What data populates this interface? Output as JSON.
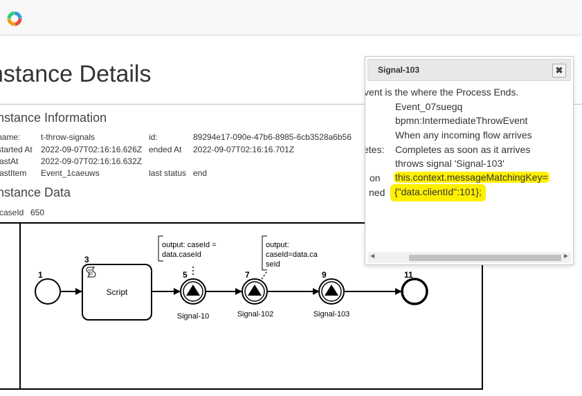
{
  "page": {
    "title": "nstance Details",
    "info_heading": "nstance Information",
    "data_heading": "nstance Data"
  },
  "info": {
    "name_label": "name:",
    "name_value": "t-throw-signals",
    "id_label": "id:",
    "id_value": "89294e17-090e-47b6-8985-6cb3528a6b56",
    "started_label": "started At",
    "started_value": "2022-09-07T02:16:16.626Z",
    "ended_label": "ended At",
    "ended_value": "2022-09-07T02:16:16.701Z",
    "lastat_label": "astAt",
    "lastat_value": "2022-09-07T02:16:16.632Z",
    "lastitem_label": "astItem",
    "lastitem_value": "Event_1caeuws",
    "laststatus_label": "last status",
    "laststatus_value": "end"
  },
  "instance_data": {
    "key": "caseId",
    "value": "650"
  },
  "diagram": {
    "start_num": "1",
    "task_num": "3",
    "task_label": "Script",
    "event5_num": "5",
    "event5_label": "Signal-10",
    "event7_num": "7",
    "event7_label": "Signal-102",
    "event9_num": "9",
    "event9_label": "Signal-103",
    "end_num": "11",
    "annotation1": [
      "output: caseId =",
      "data.caseId"
    ],
    "annotation2": [
      "output:",
      "caseId=data.ca",
      "seId"
    ]
  },
  "popup": {
    "title": "Signal-103",
    "close_label": "✖",
    "lines": [
      {
        "label": "",
        "value": "vent is the where the Process Ends."
      },
      {
        "label": "",
        "value": "Event_07suegq"
      },
      {
        "label": "",
        "value": "bpmn:IntermediateThrowEvent"
      },
      {
        "label": "",
        "value": "When any incoming flow arrives"
      },
      {
        "label": "etes:",
        "value": "Completes as soon as it arrives"
      },
      {
        "label": "",
        "value": "throws signal 'Signal-103'"
      },
      {
        "label": "on",
        "value": "this.context.messageMatchingKey="
      },
      {
        "label": "ned",
        "value": "{\"data.clientId\":101};"
      }
    ]
  },
  "colors": {
    "highlight": "#fff000",
    "logo": [
      "#e74c3c",
      "#f39c12",
      "#2ecc71",
      "#3498db"
    ]
  }
}
